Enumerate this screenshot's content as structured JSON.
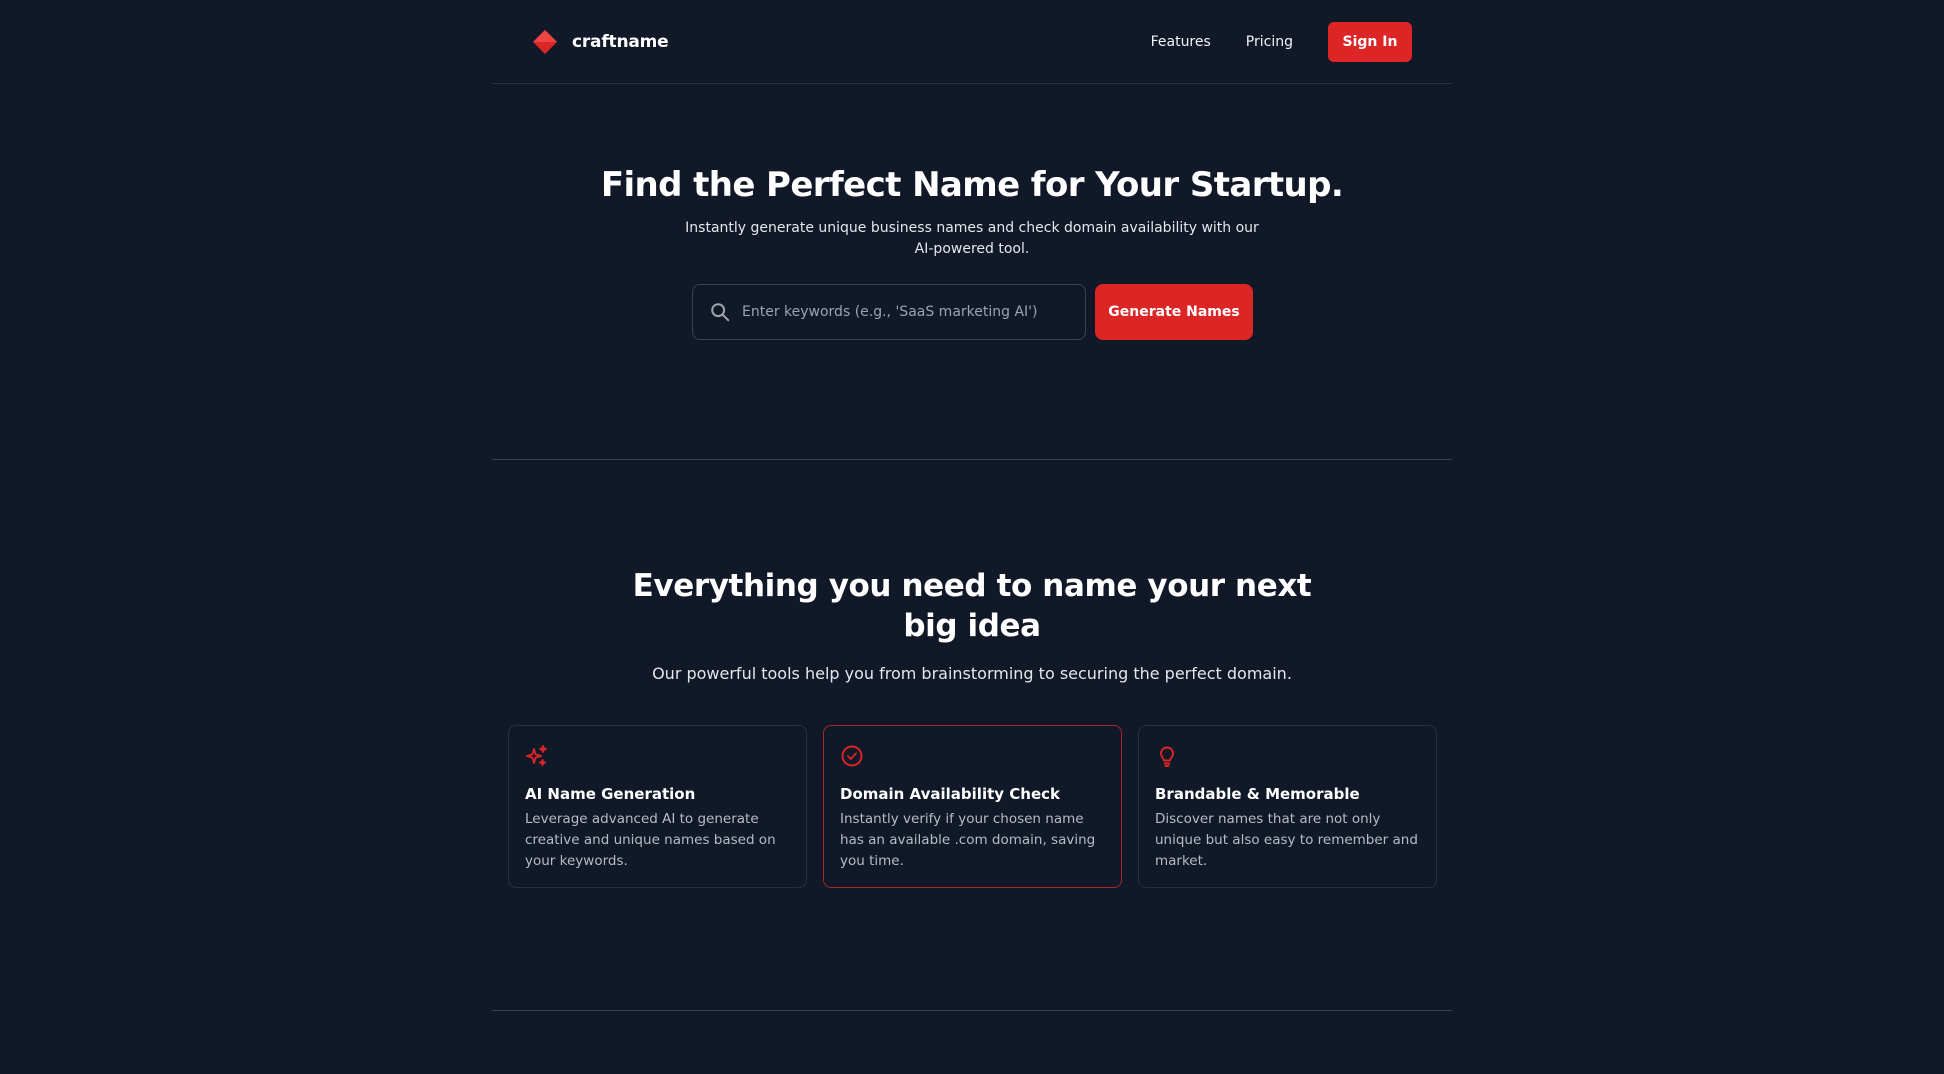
{
  "brand": {
    "name": "craftname",
    "logo_icon": "diamond-logo-icon",
    "accent_color": "#dc2626"
  },
  "nav": {
    "features": "Features",
    "pricing": "Pricing",
    "sign_in": "Sign In"
  },
  "hero": {
    "title": "Find the Perfect Name for Your Startup.",
    "subtitle": "Instantly generate unique business names and check domain availability with our AI-powered tool.",
    "search": {
      "icon": "search-icon",
      "placeholder": "Enter keywords (e.g., 'SaaS marketing AI')",
      "value": ""
    },
    "generate_label": "Generate Names"
  },
  "features": {
    "title": "Everything you need to name your next big idea",
    "subtitle": "Our powerful tools help you from brainstorming to securing the perfect domain.",
    "cards": [
      {
        "icon": "sparkles-icon",
        "title": "AI Name Generation",
        "description": "Leverage advanced AI to generate creative and unique names based on your keywords."
      },
      {
        "icon": "check-circle-icon",
        "title": "Domain Availability Check",
        "description": "Instantly verify if your chosen name has an available .com domain, saving you time."
      },
      {
        "icon": "lightbulb-icon",
        "title": "Brandable & Memorable",
        "description": "Discover names that are not only unique but also easy to remember and market."
      }
    ]
  }
}
